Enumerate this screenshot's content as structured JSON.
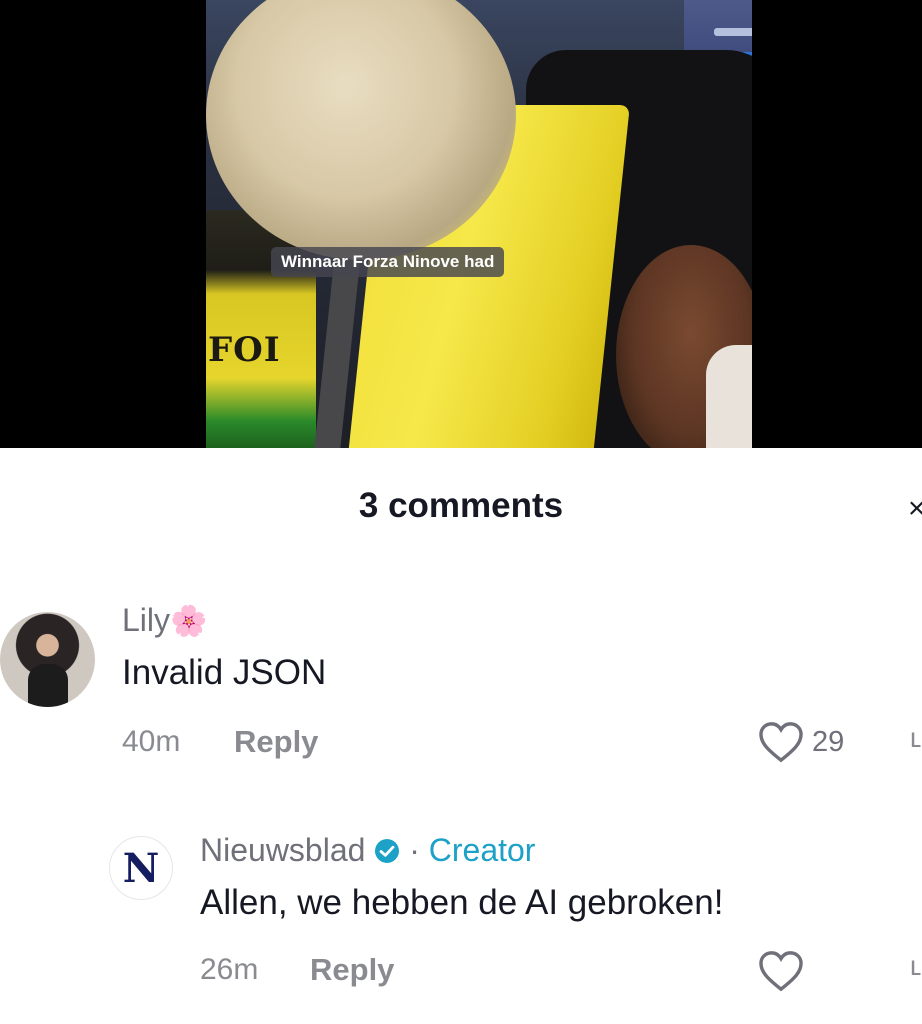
{
  "video": {
    "caption": "Winnaar Forza Ninove had",
    "shirt_text": "FOI"
  },
  "comments_header": {
    "title": "3 comments"
  },
  "comments": [
    {
      "username": "Lily",
      "username_emoji": "🌸",
      "text": "Invalid JSON",
      "time": "40m",
      "reply_label": "Reply",
      "likes": "29"
    },
    {
      "username": "Nieuwsblad",
      "badge": "·",
      "role": "Creator",
      "avatar_letter": "N",
      "text": "Allen, we hebben de AI gebroken!",
      "time": "26m",
      "reply_label": "Reply",
      "likes": ""
    }
  ],
  "icons": {
    "like": "heart-outline-icon",
    "verified": "verified-badge-icon",
    "close": "close-icon"
  },
  "colors": {
    "creator": "#1da1c6",
    "text": "#161823",
    "muted": "#8a8b91"
  }
}
